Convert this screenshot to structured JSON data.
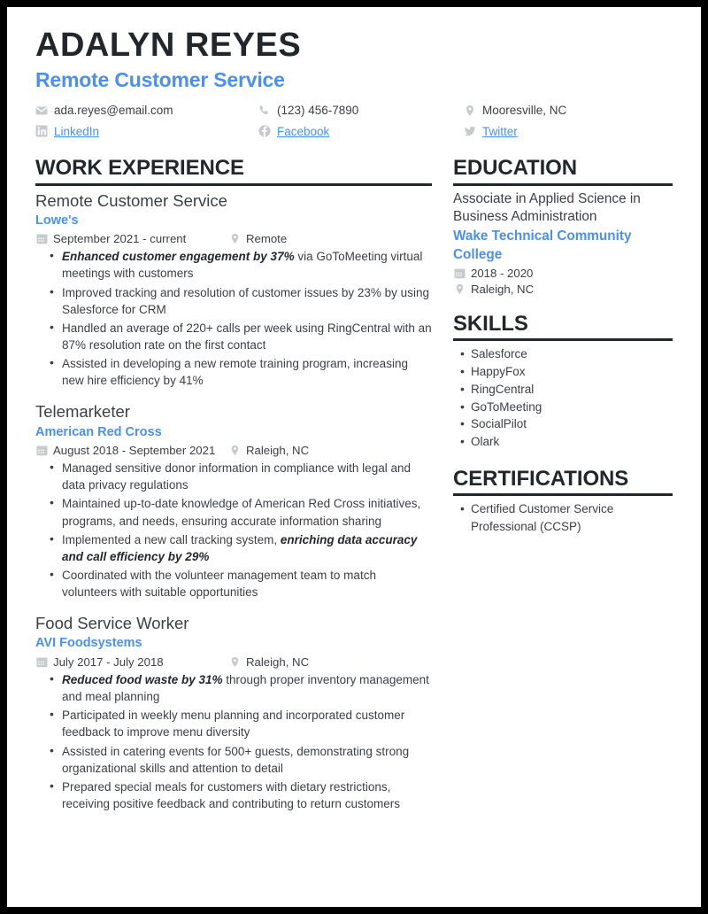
{
  "header": {
    "name": "ADALYN REYES",
    "job_title": "Remote Customer Service",
    "accent_color": "#4a90f2",
    "text_color": "#22272c",
    "contacts": [
      {
        "icon": "envelope-icon",
        "label": "ada.reyes@email.com",
        "link": false
      },
      {
        "icon": "phone-icon",
        "label": "(123) 456-7890",
        "link": false
      },
      {
        "icon": "location-pin-icon",
        "label": "Mooresville, NC",
        "link": false
      },
      {
        "icon": "linkedin-icon",
        "label": "LinkedIn",
        "link": true
      },
      {
        "icon": "facebook-icon",
        "label": "Facebook",
        "link": true
      },
      {
        "icon": "twitter-icon",
        "label": "Twitter",
        "link": true
      }
    ]
  },
  "work_experience": {
    "heading": "WORK EXPERIENCE",
    "entries": [
      {
        "title": "Remote Customer Service",
        "organization": "Lowe's",
        "dates": "September 2021 - current",
        "location": "Remote",
        "bullets": [
          {
            "bold": "Enhanced customer engagement by 37%",
            "rest": " via GoToMeeting virtual meetings with customers"
          },
          {
            "bold": "",
            "rest": "Improved tracking and resolution of customer issues by 23% by using Salesforce for CRM"
          },
          {
            "bold": "",
            "rest": "Handled an average of 220+ calls per week using RingCentral with an 87% resolution rate on the first contact"
          },
          {
            "bold": "",
            "rest": "Assisted in developing a new remote training program, increasing new hire efficiency by 41%"
          }
        ]
      },
      {
        "title": "Telemarketer",
        "organization": "American Red Cross",
        "dates": "August 2018 - September 2021",
        "location": "Raleigh, NC",
        "bullets": [
          {
            "bold": "",
            "rest": "Managed sensitive donor information in compliance with legal and data privacy regulations"
          },
          {
            "bold": "",
            "rest": "Maintained up-to-date knowledge of American Red Cross initiatives, programs, and needs, ensuring accurate information sharing"
          },
          {
            "bold": "",
            "rest": "Implemented a new call tracking system, ",
            "bold_after": "enriching data accuracy and call efficiency by 29%"
          },
          {
            "bold": "",
            "rest": "Coordinated with the volunteer management team to match volunteers with suitable opportunities"
          }
        ]
      },
      {
        "title": "Food Service Worker",
        "organization": "AVI Foodsystems",
        "dates": "July 2017 - July 2018",
        "location": "Raleigh, NC",
        "bullets": [
          {
            "bold": "Reduced food waste by 31%",
            "rest": " through proper inventory management and meal planning"
          },
          {
            "bold": "",
            "rest": "Participated in weekly menu planning and incorporated customer feedback to improve menu diversity"
          },
          {
            "bold": "",
            "rest": "Assisted in catering events for 500+ guests, demonstrating strong organizational skills and attention to detail"
          },
          {
            "bold": "",
            "rest": "Prepared special meals for customers with dietary restrictions, receiving positive feedback and contributing to return customers"
          }
        ]
      }
    ]
  },
  "education": {
    "heading": "EDUCATION",
    "degree": "Associate in Applied Science in Business Administration",
    "school": "Wake Technical Community College",
    "dates": "2018 - 2020",
    "location": "Raleigh, NC"
  },
  "skills": {
    "heading": "SKILLS",
    "items": [
      "Salesforce",
      "HappyFox",
      "RingCentral",
      "GoToMeeting",
      "SocialPilot",
      "Olark"
    ]
  },
  "certifications": {
    "heading": "CERTIFICATIONS",
    "items": [
      "Certified Customer Service Professional (CCSP)"
    ]
  }
}
